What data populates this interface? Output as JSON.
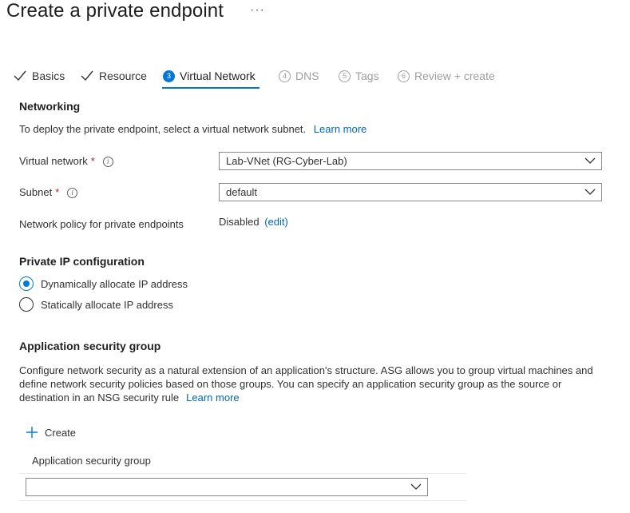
{
  "page": {
    "title": "Create a private endpoint",
    "more_label": "···"
  },
  "steps": [
    {
      "label": "Basics",
      "state": "done"
    },
    {
      "label": "Resource",
      "state": "done"
    },
    {
      "label": "Virtual Network",
      "number": "3",
      "state": "active"
    },
    {
      "label": "DNS",
      "number": "4",
      "state": "pending"
    },
    {
      "label": "Tags",
      "number": "5",
      "state": "pending"
    },
    {
      "label": "Review + create",
      "number": "6",
      "state": "pending"
    }
  ],
  "networking": {
    "heading": "Networking",
    "description": "To deploy the private endpoint, select a virtual network subnet.",
    "learn_more": "Learn more",
    "virtual_network_label": "Virtual network",
    "virtual_network_value": "Lab-VNet (RG-Cyber-Lab)",
    "subnet_label": "Subnet",
    "subnet_value": "default",
    "required_mark": "*",
    "policy_label": "Network policy for private endpoints",
    "policy_value": "Disabled",
    "policy_edit": "(edit)"
  },
  "private_ip": {
    "heading": "Private IP configuration",
    "options": [
      {
        "label": "Dynamically allocate IP address",
        "selected": true
      },
      {
        "label": "Statically allocate IP address",
        "selected": false
      }
    ]
  },
  "asg": {
    "heading": "Application security group",
    "description_line1": "Configure network security as a natural extension of an application's structure. ASG allows you to group virtual machines and",
    "description_line2": "define network security policies based on those groups. You can specify an application security group as the source or",
    "description_line3": "destination in an NSG security rule",
    "learn_more": "Learn more",
    "create_label": "Create",
    "column_header": "Application security group",
    "dropdown_value": ""
  },
  "colors": {
    "accent": "#0078d4",
    "link": "#0067b8",
    "required": "#a4262c"
  }
}
